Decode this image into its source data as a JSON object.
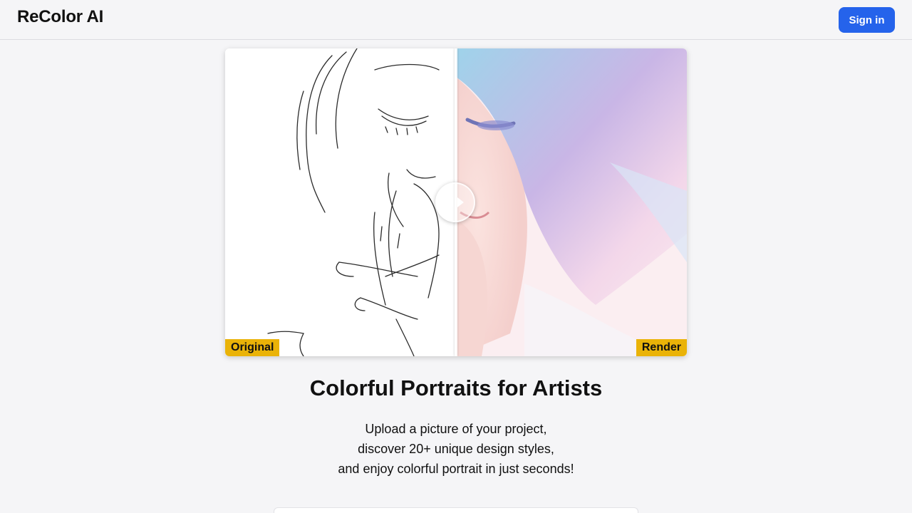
{
  "header": {
    "brand": "ReColor AI",
    "signin_label": "Sign in"
  },
  "comparison": {
    "left_label": "Original",
    "right_label": "Render",
    "slider_position": 0.5
  },
  "hero": {
    "title": "Colorful Portraits for Artists",
    "lines": [
      "Upload a picture of your project,",
      "discover 20+ unique design styles,",
      "and enjoy colorful portrait in just seconds!"
    ]
  },
  "colors": {
    "accent": "#2563eb",
    "tag": "#eab308",
    "background": "#f5f5f7"
  }
}
